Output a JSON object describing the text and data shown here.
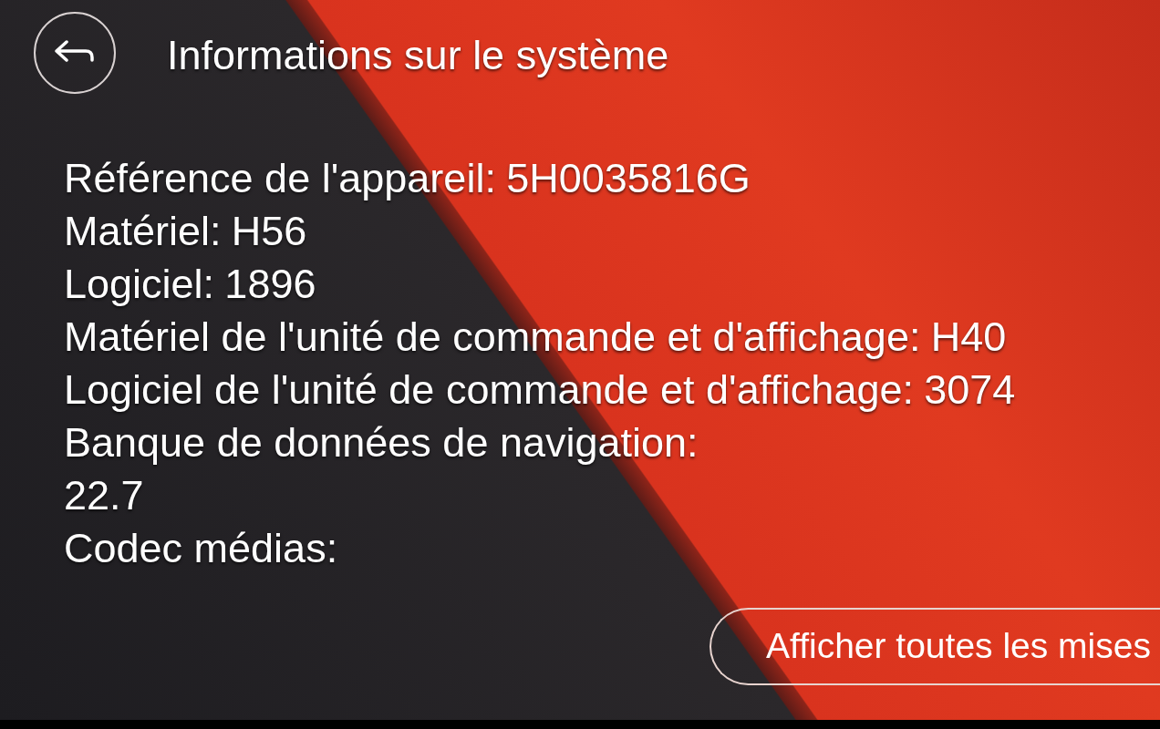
{
  "header": {
    "title": "Informations sur le système"
  },
  "info": [
    {
      "kind": "inline",
      "label": "Référence de l'appareil:",
      "value": "5H0035816G"
    },
    {
      "kind": "inline",
      "label": "Matériel:",
      "value": "H56"
    },
    {
      "kind": "inline",
      "label": "Logiciel:",
      "value": "1896"
    },
    {
      "kind": "inline",
      "label": "Matériel de l'unité de commande et d'affichage:",
      "value": "H40"
    },
    {
      "kind": "inline",
      "label": "Logiciel de l'unité de commande et d'affichage:",
      "value": "3074"
    },
    {
      "kind": "stacked",
      "label": "Banque de données de navigation:",
      "value": "22.7"
    },
    {
      "kind": "inline",
      "label": "Codec médias:"
    }
  ],
  "button": {
    "label": "Afficher toutes les mises"
  }
}
